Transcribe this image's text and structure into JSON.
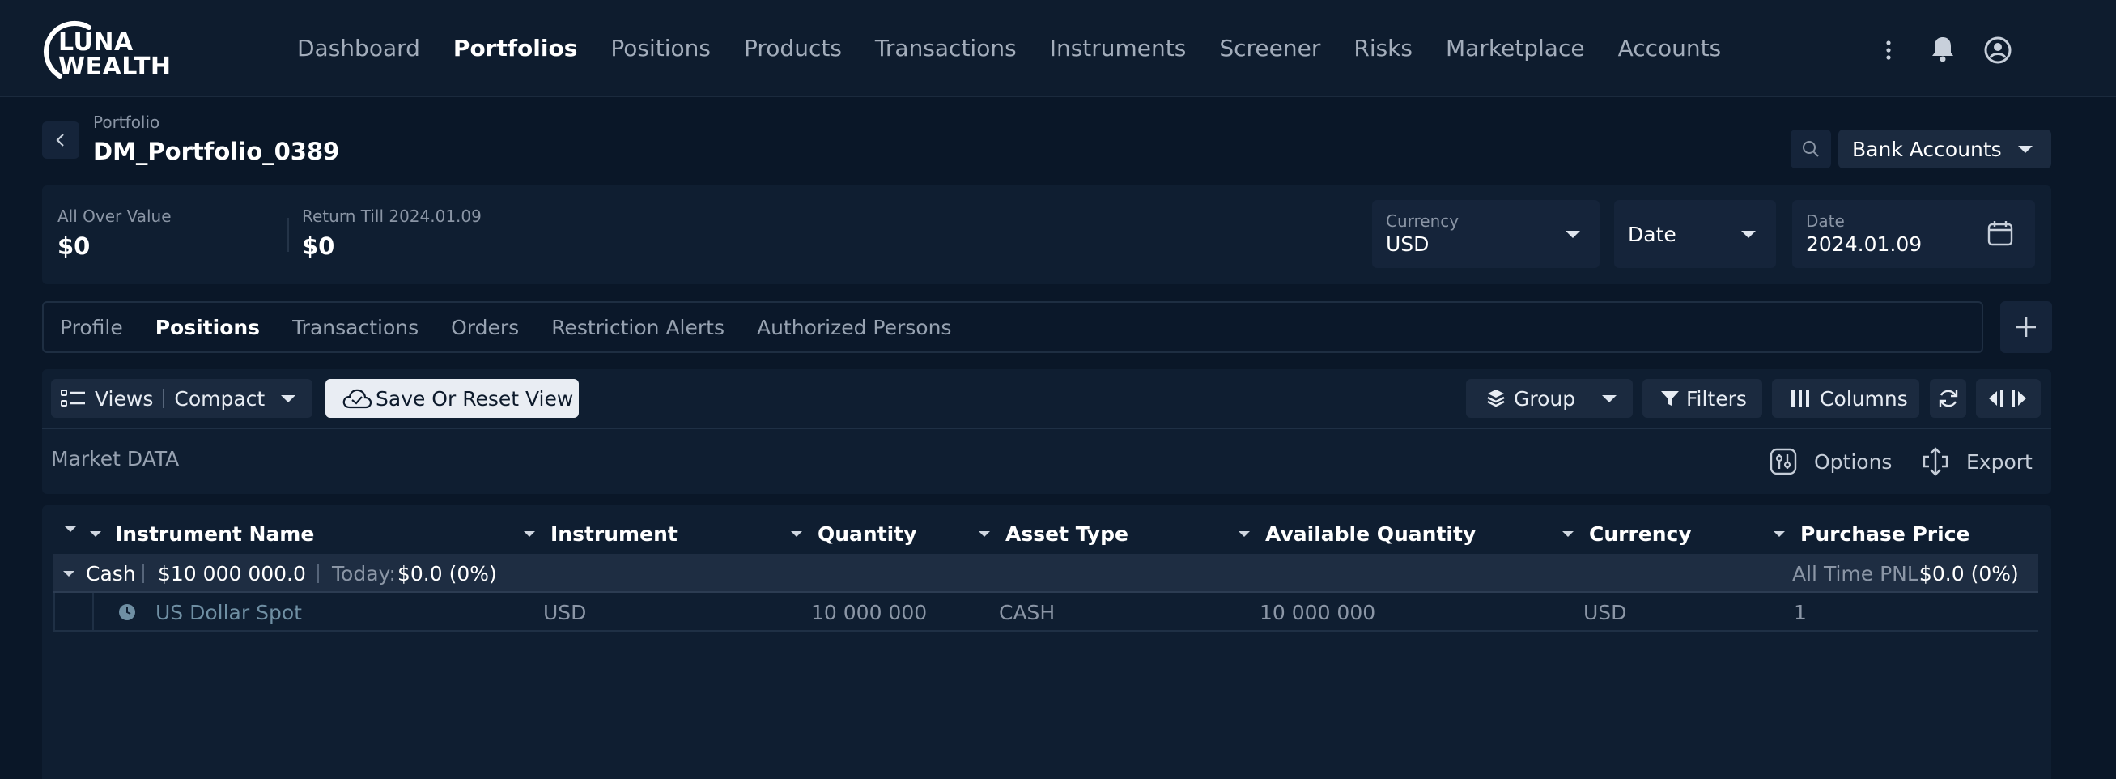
{
  "brand": {
    "line1": "LUNA",
    "line2": "WEALTH",
    "icon": "luna-arc-logo"
  },
  "nav": {
    "items": [
      {
        "label": "Dashboard",
        "active": false
      },
      {
        "label": "Portfolios",
        "active": true
      },
      {
        "label": "Positions",
        "active": false
      },
      {
        "label": "Products",
        "active": false
      },
      {
        "label": "Transactions",
        "active": false
      },
      {
        "label": "Instruments",
        "active": false
      },
      {
        "label": "Screener",
        "active": false
      },
      {
        "label": "Risks",
        "active": false
      },
      {
        "label": "Marketplace",
        "active": false
      },
      {
        "label": "Accounts",
        "active": false
      }
    ],
    "icons": [
      "more-vertical-icon",
      "bell-icon",
      "user-circle-icon"
    ]
  },
  "header": {
    "breadcrumb": "Portfolio",
    "title": "DM_Portfolio_0389",
    "bank_select": "Bank Accounts"
  },
  "summary": {
    "all_over_label": "All Over Value",
    "all_over_value": "$0",
    "return_label": "Return Till 2024.01.09",
    "return_value": "$0",
    "currency_label": "Currency",
    "currency_value": "USD",
    "date_select": "Date",
    "date_label": "Date",
    "date_value": "2024.01.09"
  },
  "tabs": [
    {
      "label": "Profile",
      "active": false
    },
    {
      "label": "Positions",
      "active": true
    },
    {
      "label": "Transactions",
      "active": false
    },
    {
      "label": "Orders",
      "active": false
    },
    {
      "label": "Restriction Alerts",
      "active": false
    },
    {
      "label": "Authorized Persons",
      "active": false
    }
  ],
  "toolbar": {
    "views_label": "Views",
    "views_value": "Compact",
    "save_reset": "Save Or Reset View",
    "group": "Group",
    "filters": "Filters",
    "columns": "Columns",
    "market_data": "Market DATA",
    "options": "Options",
    "export": "Export"
  },
  "table": {
    "columns": [
      "Instrument Name",
      "Instrument",
      "Quantity",
      "Asset Type",
      "Available Quantity",
      "Currency",
      "Purchase Price"
    ],
    "group": {
      "name": "Cash",
      "total": "$10 000 000.0",
      "today_label": "Today:",
      "today_value": "$0.0 (0%)",
      "pnl_label": "All Time PNL:",
      "pnl_value": "$0.0 (0%)"
    },
    "rows": [
      {
        "name": "US Dollar Spot",
        "instrument": "USD",
        "quantity": "10 000 000",
        "asset_type": "CASH",
        "available": "10 000 000",
        "currency": "USD",
        "purchase_price": "1",
        "status_color": "#6f8fa3"
      }
    ]
  },
  "colors": {
    "background": "#0a1728",
    "panel": "#0f1e31",
    "button": "#1b2a3f",
    "accent_light": "#e9edf3"
  }
}
